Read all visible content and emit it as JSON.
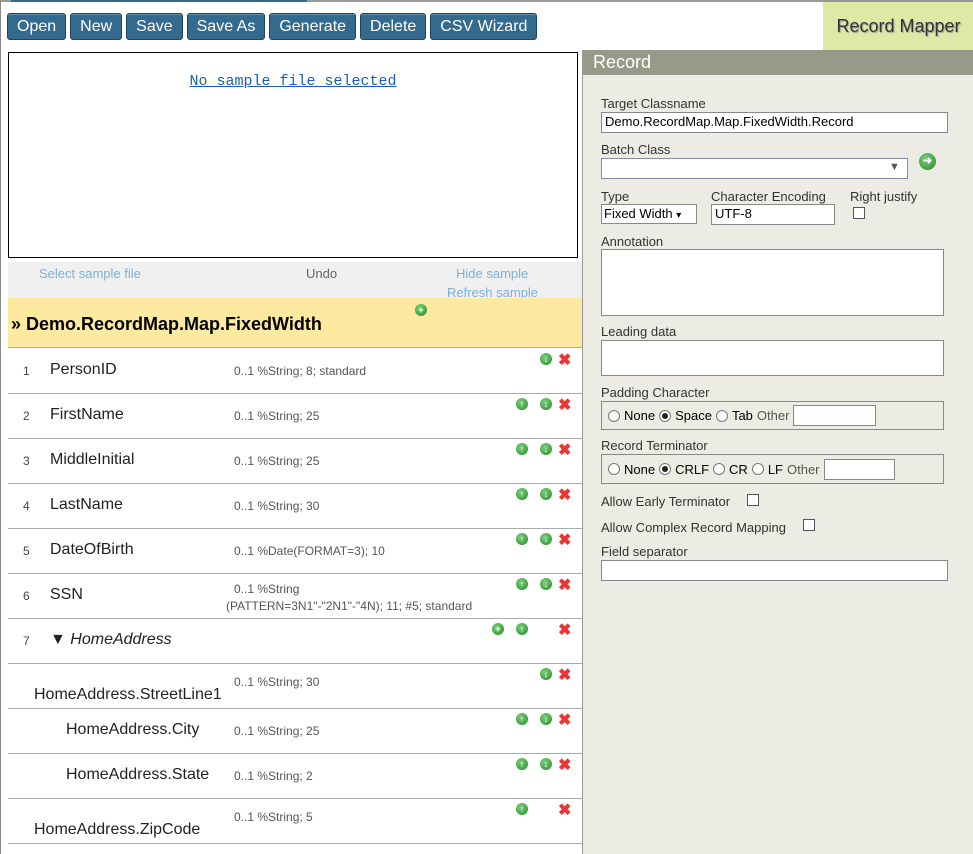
{
  "toolbar": {
    "buttons": [
      "Open",
      "New",
      "Save",
      "Save As",
      "Generate",
      "Delete",
      "CSV Wizard"
    ]
  },
  "brand": "Record Mapper",
  "sample": {
    "message": "No sample file selected",
    "select": "Select sample file",
    "undo": "Undo",
    "hide": "Hide sample",
    "refresh": "Refresh sample"
  },
  "record_header": "» Demo.RecordMap.Map.FixedWidth",
  "fields": [
    {
      "num": "1",
      "name": "PersonID",
      "type": "0..1 %String; 8; standard",
      "icons": [
        "down",
        "x"
      ]
    },
    {
      "num": "2",
      "name": "FirstName",
      "type": "0..1 %String; 25",
      "icons": [
        "up",
        "down",
        "x"
      ]
    },
    {
      "num": "3",
      "name": "MiddleInitial",
      "type": "0..1 %String; 25",
      "icons": [
        "up",
        "down",
        "x"
      ]
    },
    {
      "num": "4",
      "name": "LastName",
      "type": "0..1 %String; 30",
      "icons": [
        "up",
        "down",
        "x"
      ]
    },
    {
      "num": "5",
      "name": "DateOfBirth",
      "type": "0..1 %Date(FORMAT=3); 10",
      "icons": [
        "up",
        "down",
        "x"
      ]
    },
    {
      "num": "6",
      "name": "SSN",
      "type": "0..1 %String",
      "type2": "(PATTERN=3N1\"-\"2N1\"-\"4N); 11; #5; standard",
      "icons": [
        "up",
        "down",
        "x"
      ]
    },
    {
      "num": "7",
      "name": "▼ HomeAddress",
      "type": "",
      "italic": true,
      "icons": [
        "plus",
        "up",
        "x"
      ]
    },
    {
      "num": "",
      "name": "HomeAddress.StreetLine1",
      "type": "0..1 %String; 30",
      "indent": "low",
      "icons": [
        "down",
        "x"
      ]
    },
    {
      "num": "",
      "name": "HomeAddress.City",
      "type": "0..1 %String; 25",
      "indent": "deep",
      "icons": [
        "up",
        "down",
        "x"
      ]
    },
    {
      "num": "",
      "name": "HomeAddress.State",
      "type": "0..1 %String; 2",
      "indent": "deep",
      "icons": [
        "up",
        "down",
        "x"
      ]
    },
    {
      "num": "",
      "name": "HomeAddress.ZipCode",
      "type": "0..1 %String; 5",
      "indent": "low",
      "icons": [
        "up",
        "x"
      ]
    }
  ],
  "record": {
    "title": "Record",
    "target_label": "Target Classname",
    "target_value": "Demo.RecordMap.Map.FixedWidth.Record",
    "batch_label": "Batch Class",
    "batch_value": "",
    "type_label": "Type",
    "type_value": "Fixed Width",
    "encoding_label": "Character Encoding",
    "encoding_value": "UTF-8",
    "right_justify_label": "Right justify",
    "right_justify": false,
    "annotation_label": "Annotation",
    "leading_label": "Leading data",
    "padding_label": "Padding Character",
    "padding_options": [
      "None",
      "Space",
      "Tab"
    ],
    "padding_selected": "Space",
    "other_label": "Other",
    "terminator_label": "Record Terminator",
    "terminator_options": [
      "None",
      "CRLF",
      "CR",
      "LF"
    ],
    "terminator_selected": "CRLF",
    "early_label": "Allow Early Terminator",
    "early": false,
    "complex_label": "Allow Complex Record Mapping",
    "complex": false,
    "separator_label": "Field separator"
  }
}
